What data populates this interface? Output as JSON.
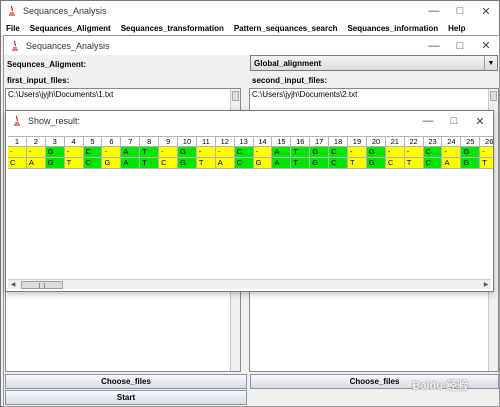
{
  "main_window": {
    "title": "Sequances_Analysis",
    "menu": [
      "File",
      "Sequances_Aligment",
      "Sequances_transformation",
      "Pattern_sequances_search",
      "Sequances_information",
      "Help"
    ]
  },
  "inner_window": {
    "title": "Sequances_Analysis",
    "alignment_label": "Sequnces_Aligment:",
    "alignment_select": "Global_alignment",
    "first_files_label": "first_input_files:",
    "second_files_label": "second_input_files:",
    "first_file_path": "C:\\Users\\jyjh\\Documents\\1.txt",
    "second_file_path": "C:\\Users\\jyjh\\Documents\\2.txt",
    "choose_files_left": "Choose_files",
    "choose_files_right": "Choose_files",
    "start_button": "Start"
  },
  "result_window": {
    "title": "Show_result:",
    "columns": [
      "1",
      "2",
      "3",
      "4",
      "5",
      "6",
      "7",
      "8",
      "9",
      "10",
      "11",
      "12",
      "13",
      "14",
      "15",
      "16",
      "17",
      "18",
      "19",
      "20",
      "21",
      "22",
      "23",
      "24",
      "25",
      "26"
    ],
    "row1": [
      "-",
      "-",
      "G",
      "-",
      "C",
      "-",
      "A",
      "T",
      "-",
      "G",
      "-",
      "-",
      "C",
      "-",
      "A",
      "T",
      "G",
      "C",
      "-",
      "G",
      "-",
      "-",
      "C",
      "-",
      "G",
      "-"
    ],
    "row2": [
      "C",
      "A",
      "G",
      "T",
      "C",
      "G",
      "A",
      "T",
      "C",
      "G",
      "T",
      "A",
      "C",
      "G",
      "A",
      "T",
      "G",
      "C",
      "T",
      "G",
      "C",
      "T",
      "C",
      "A",
      "G",
      "T"
    ],
    "match_color": "#00e400",
    "gap_color": "#ffff00"
  },
  "watermark": "Baidu 经验"
}
